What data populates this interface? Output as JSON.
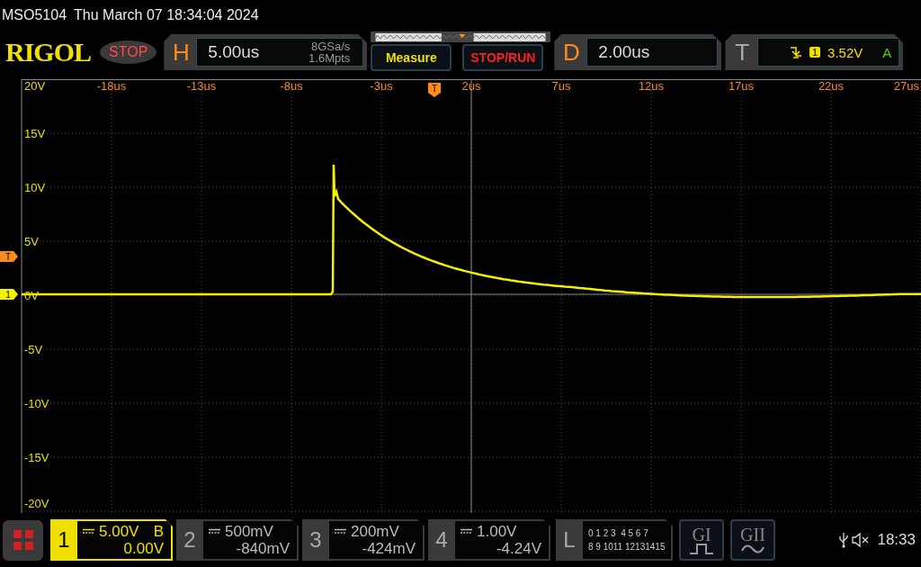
{
  "status_line": {
    "model": "MSO5104",
    "datetime": "Thu March 07 18:34:04 2024"
  },
  "header": {
    "logo": "RIGOL",
    "run_state": "STOP",
    "horizontal": {
      "letter": "H",
      "scale": "5.00us",
      "sample_rate": "8GSa/s",
      "memory_depth": "1.6Mpts"
    },
    "buttons": [
      {
        "label": "Measure",
        "kind": "measure"
      },
      {
        "label": "STOP/RUN",
        "kind": "stoprun"
      }
    ],
    "delay": {
      "letter": "D",
      "value": "2.00us"
    },
    "trigger": {
      "letter": "T",
      "source": "1",
      "level": "3.52V",
      "mode": "A"
    }
  },
  "plot": {
    "y_labels": [
      "20V",
      "15V",
      "10V",
      "5V",
      "0V",
      "-5V",
      "-10V",
      "-15V",
      "-20V"
    ],
    "x_labels": [
      "-18us",
      "-13us",
      "-8us",
      "-3us",
      "2us",
      "7us",
      "12us",
      "17us",
      "22us",
      "27us"
    ],
    "trigger_position_marker": "T",
    "trigger_level_marker": "T",
    "channel_marker": "1"
  },
  "channels": [
    {
      "number": "1",
      "scale": "5.00V",
      "offset": "0.00V",
      "bandwidth_limit": "B",
      "selected": true
    },
    {
      "number": "2",
      "scale": "500mV",
      "offset": "-840mV",
      "selected": false
    },
    {
      "number": "3",
      "scale": "200mV",
      "offset": "-424mV",
      "selected": false
    },
    {
      "number": "4",
      "scale": "1.00V",
      "offset": "-4.24V",
      "selected": false
    }
  ],
  "logic": {
    "letter": "L",
    "row_1": "0 1 2 3  4 5 6 7",
    "row_2": "8 9 1011 12131415"
  },
  "generators": [
    {
      "label": "GI",
      "kind": "pulse"
    },
    {
      "label": "GII",
      "kind": "sine"
    }
  ],
  "clock": "18:33"
}
